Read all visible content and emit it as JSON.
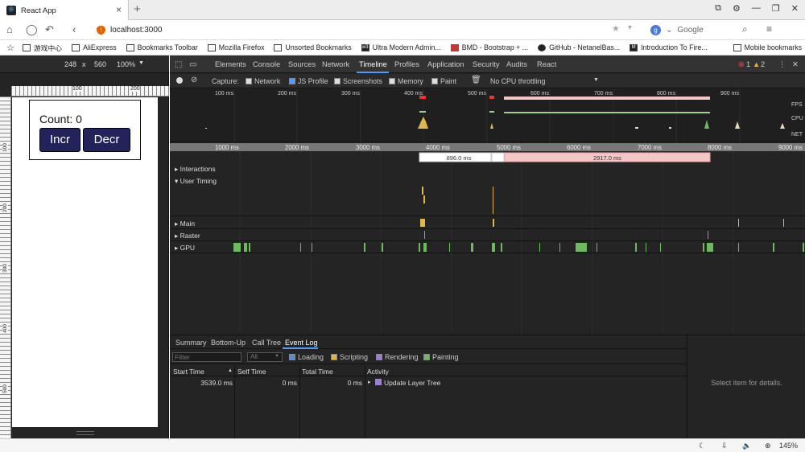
{
  "browser": {
    "tab_title": "React App",
    "tab_close": "×",
    "new_tab": "+",
    "url": "localhost:3000",
    "search_engine": "Google",
    "window_buttons": [
      "⧉",
      "⚙",
      "—",
      "❐",
      "✕"
    ]
  },
  "bookmarks": [
    {
      "label": "游戏中心",
      "icon": "folder-icon"
    },
    {
      "label": "AliExpress",
      "icon": "folder-icon"
    },
    {
      "label": "Bookmarks Toolbar",
      "icon": "folder-icon"
    },
    {
      "label": "Mozilla Firefox",
      "icon": "folder-icon"
    },
    {
      "label": "Unsorted Bookmarks",
      "icon": "folder-icon"
    },
    {
      "label": "Ultra Modern Admin...",
      "icon": "w3-icon"
    },
    {
      "label": "BMD - Bootstrap + ...",
      "icon": "bmd-icon"
    },
    {
      "label": "GitHub - NetanelBas...",
      "icon": "github-icon"
    },
    {
      "label": "Introduction To Fire...",
      "icon": "medium-icon"
    },
    {
      "label": "Mobile bookmarks",
      "icon": "folder-icon"
    }
  ],
  "device": {
    "width": "248",
    "times": "x",
    "height": "560",
    "zoom": "100%"
  },
  "app": {
    "count_label": "Count: 0",
    "incr": "Incr",
    "decr": "Decr"
  },
  "ruler": {
    "top": [
      "100",
      "200"
    ],
    "left": [
      "100",
      "200",
      "300",
      "400",
      "500"
    ]
  },
  "devtools": {
    "tabs": [
      "Elements",
      "Console",
      "Sources",
      "Network",
      "Timeline",
      "Profiles",
      "Application",
      "Security",
      "Audits",
      "React"
    ],
    "active_tab": "Timeline",
    "errors": "1",
    "warnings": "2",
    "toolbar": {
      "capture": "Capture:",
      "network": "Network",
      "js_profile": "JS Profile",
      "screenshots": "Screenshots",
      "memory": "Memory",
      "paint": "Paint",
      "throttling": "No CPU throttling"
    },
    "overview_ticks": [
      "100 ms",
      "200 ms",
      "300 ms",
      "400 ms",
      "500 ms",
      "600 ms",
      "700 ms",
      "800 ms",
      "900 ms"
    ],
    "overview_labels": [
      "FPS",
      "CPU",
      "NET"
    ],
    "time_axis": [
      "1000 ms",
      "2000 ms",
      "3000 ms",
      "4000 ms",
      "5000 ms",
      "6000 ms",
      "7000 ms",
      "8000 ms",
      "9000 ms"
    ],
    "frames": [
      "896.0 ms",
      "2917.0 ms"
    ],
    "rows": [
      "Interactions",
      "User Timing",
      "Main",
      "Raster",
      "GPU"
    ],
    "bottom_tabs": [
      "Summary",
      "Bottom-Up",
      "Call Tree",
      "Event Log"
    ],
    "active_bottom_tab": "Event Log",
    "filter_placeholder": "Filter",
    "filter_select": "All",
    "categories": [
      {
        "label": "Loading",
        "color": "#5b8bd8"
      },
      {
        "label": "Scripting",
        "color": "#e0b64b"
      },
      {
        "label": "Rendering",
        "color": "#9b7fd9"
      },
      {
        "label": "Painting",
        "color": "#6dbb5e"
      }
    ],
    "columns": [
      "Start Time",
      "Self Time",
      "Total Time",
      "Activity"
    ],
    "event": {
      "start": "3539.0 ms",
      "self": "0 ms",
      "total": "0 ms",
      "activity": "Update Layer Tree"
    },
    "details_empty": "Select item for details."
  },
  "statusbar": {
    "zoom": "145%"
  }
}
